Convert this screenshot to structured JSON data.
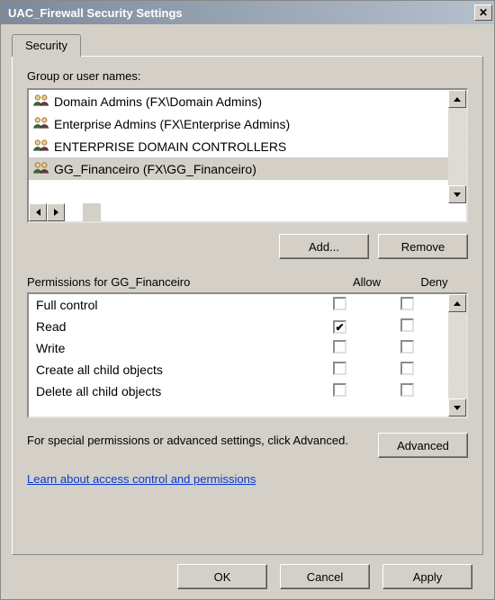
{
  "window": {
    "title": "UAC_Firewall Security Settings"
  },
  "tab": {
    "security": "Security"
  },
  "group_label": "Group or user names:",
  "groups": [
    {
      "name": "Domain Admins (FX\\Domain Admins)",
      "selected": false
    },
    {
      "name": "Enterprise Admins (FX\\Enterprise Admins)",
      "selected": false
    },
    {
      "name": "ENTERPRISE DOMAIN CONTROLLERS",
      "selected": false
    },
    {
      "name": "GG_Financeiro (FX\\GG_Financeiro)",
      "selected": true
    }
  ],
  "buttons": {
    "add": "Add...",
    "remove": "Remove",
    "advanced": "Advanced",
    "ok": "OK",
    "cancel": "Cancel",
    "apply": "Apply"
  },
  "perm_header": {
    "label": "Permissions for GG_Financeiro",
    "allow": "Allow",
    "deny": "Deny"
  },
  "permissions": [
    {
      "name": "Full control",
      "allow": false,
      "deny": false
    },
    {
      "name": "Read",
      "allow": true,
      "deny": false
    },
    {
      "name": "Write",
      "allow": false,
      "deny": false
    },
    {
      "name": "Create all child objects",
      "allow": false,
      "deny": false
    },
    {
      "name": "Delete all child objects",
      "allow": false,
      "deny": false
    }
  ],
  "advanced_text": "For special permissions or advanced settings, click Advanced.",
  "link_text": "Learn about access control and permissions"
}
